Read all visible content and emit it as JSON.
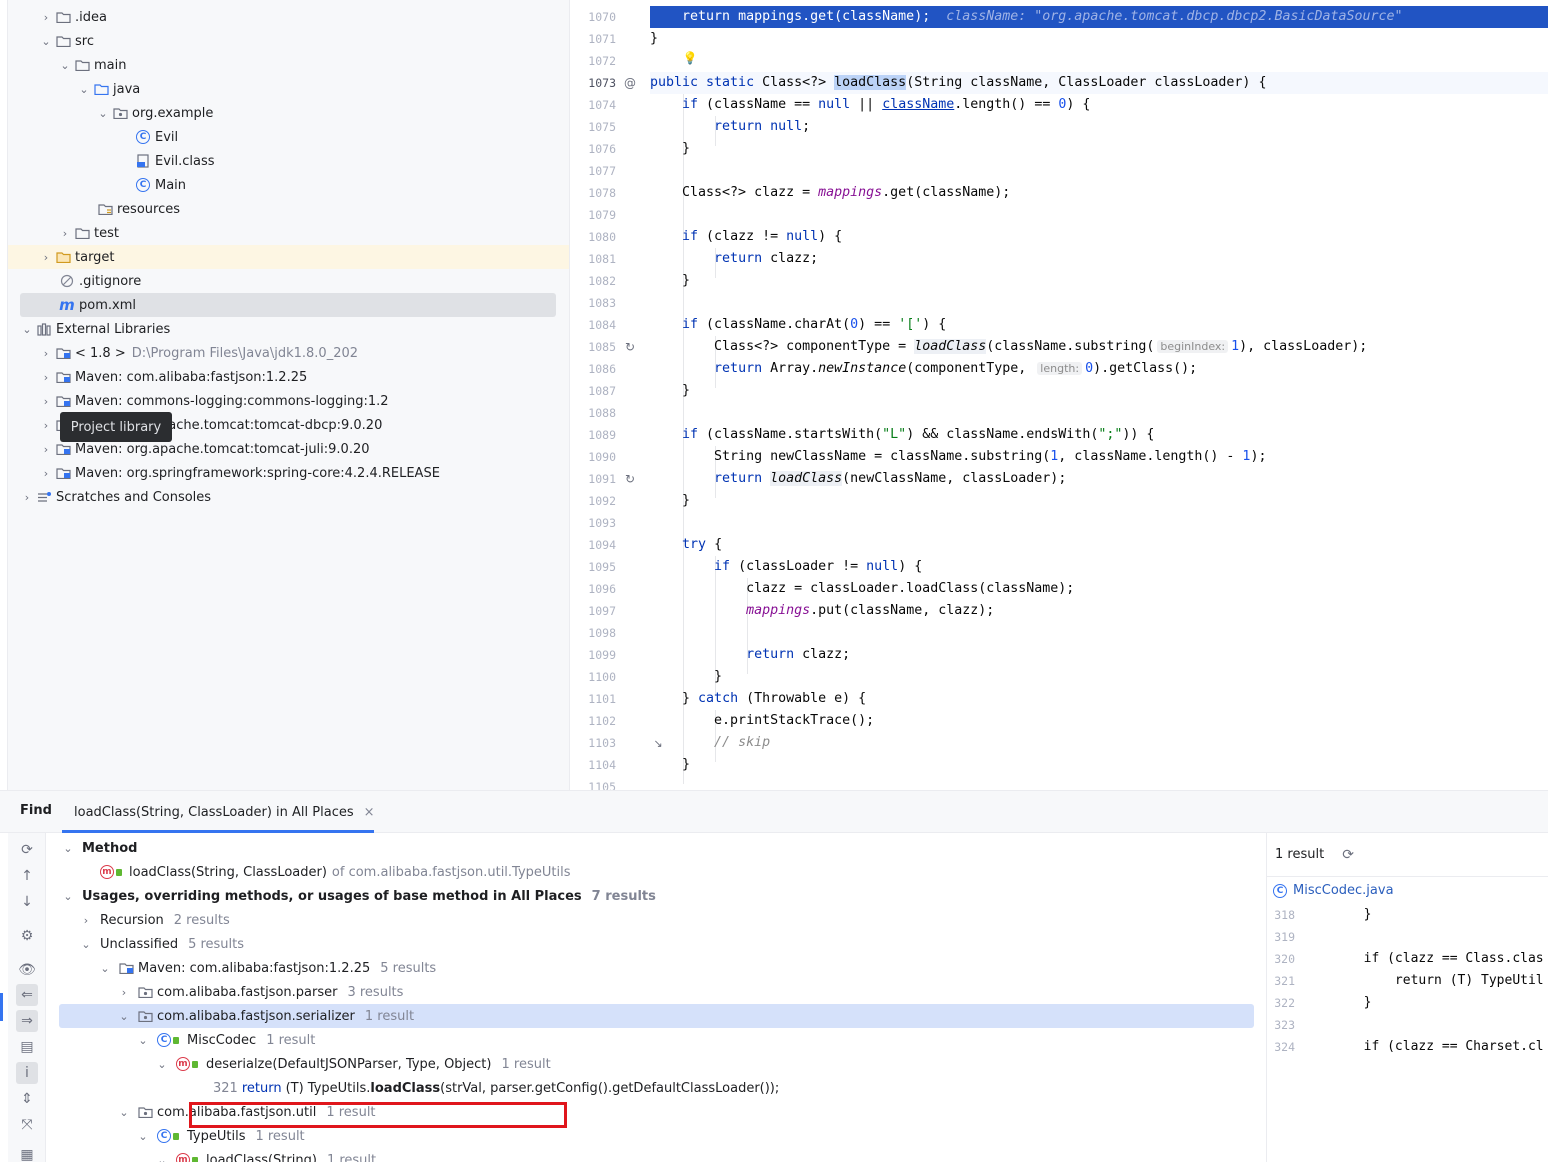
{
  "project_tree": {
    "items": [
      {
        "label": ".idea"
      },
      {
        "label": "src"
      },
      {
        "label": "main"
      },
      {
        "label": "java"
      },
      {
        "label": "org.example"
      },
      {
        "label": "Evil"
      },
      {
        "label": "Evil.class"
      },
      {
        "label": "Main"
      },
      {
        "label": "resources"
      },
      {
        "label": "test"
      },
      {
        "label": "target"
      },
      {
        "label": ".gitignore"
      },
      {
        "label": "pom.xml"
      },
      {
        "label": "External Libraries"
      },
      {
        "label": "< 1.8 >",
        "path": "D:\\Program Files\\Java\\jdk1.8.0_202"
      },
      {
        "label": "Maven: com.alibaba:fastjson:1.2.25"
      },
      {
        "label": "Maven: commons-logging:commons-logging:1.2"
      },
      {
        "label": "Maven: org.apache.tomcat:tomcat-dbcp:9.0.20"
      },
      {
        "label": "Maven: org.apache.tomcat:tomcat-juli:9.0.20"
      },
      {
        "label": "Maven: org.springframework:spring-core:4.2.4.RELEASE"
      },
      {
        "label": "Scratches and Consoles"
      }
    ],
    "tooltip": "Project library"
  },
  "editor": {
    "line_numbers": [
      "1070",
      "1071",
      "1072",
      "1073",
      "1074",
      "1075",
      "1076",
      "1077",
      "1078",
      "1079",
      "1080",
      "1081",
      "1082",
      "1083",
      "1084",
      "1085",
      "1086",
      "1087",
      "1088",
      "1089",
      "1090",
      "1091",
      "1092",
      "1093",
      "1094",
      "1095",
      "1096",
      "1097",
      "1098",
      "1099",
      "1100",
      "1101",
      "1102",
      "1103",
      "1104",
      "1105"
    ],
    "exec_line": {
      "code": "return mappings.get(className);",
      "debug_value": "className: \"org.apache.tomcat.dbcp.dbcp2.BasicDataSource\""
    },
    "hints": {
      "begin_index": "beginIndex:",
      "length": "length:"
    },
    "comment": "// skip"
  },
  "find": {
    "label": "Find",
    "tab_title": "loadClass(String, ClassLoader) in All Places",
    "tab_close": "×",
    "rows": [
      {
        "text": "Method"
      },
      {
        "text": "loadClass(String, ClassLoader)",
        "suffix": "of com.alibaba.fastjson.util.TypeUtils"
      },
      {
        "text": "Usages, overriding methods, or usages of base method in All Places",
        "count": "7 results"
      },
      {
        "text": "Recursion",
        "count": "2 results"
      },
      {
        "text": "Unclassified",
        "count": "5 results"
      },
      {
        "text": "Maven: com.alibaba:fastjson:1.2.25",
        "count": "5 results"
      },
      {
        "text": "com.alibaba.fastjson.parser",
        "count": "3 results"
      },
      {
        "text": "com.alibaba.fastjson.serializer",
        "count": "1 result"
      },
      {
        "text": "MiscCodec",
        "count": "1 result"
      },
      {
        "text": "deserialze(DefaultJSONParser, Type, Object)",
        "count": "1 result"
      },
      {
        "line": "321",
        "kw": "return",
        "pre": "(T) TypeUtils.",
        "bold": "loadClass",
        "post": "(strVal, parser.getConfig().getDefaultClassLoader());"
      },
      {
        "text": "com.alibaba.fastjson.util",
        "count": "1 result"
      },
      {
        "text": "TypeUtils",
        "count": "1 result"
      },
      {
        "text": "loadClass(String)",
        "count": "1 result"
      }
    ],
    "preview": {
      "result_count": "1 result",
      "file": "MiscCodec.java",
      "lines": [
        {
          "n": "318",
          "code": "        }"
        },
        {
          "n": "319",
          "code": ""
        },
        {
          "n": "320",
          "code": "        if (clazz == Class.clas"
        },
        {
          "n": "321",
          "code": "            return (T) TypeUtil"
        },
        {
          "n": "322",
          "code": "        }"
        },
        {
          "n": "323",
          "code": ""
        },
        {
          "n": "324",
          "code": "        if (clazz == Charset.cl"
        }
      ]
    }
  },
  "colors": {
    "accent": "#3574f0",
    "exec_line": "#2154c3",
    "highlight_box": "#e0161c",
    "selected_row": "#d5e1fa"
  }
}
